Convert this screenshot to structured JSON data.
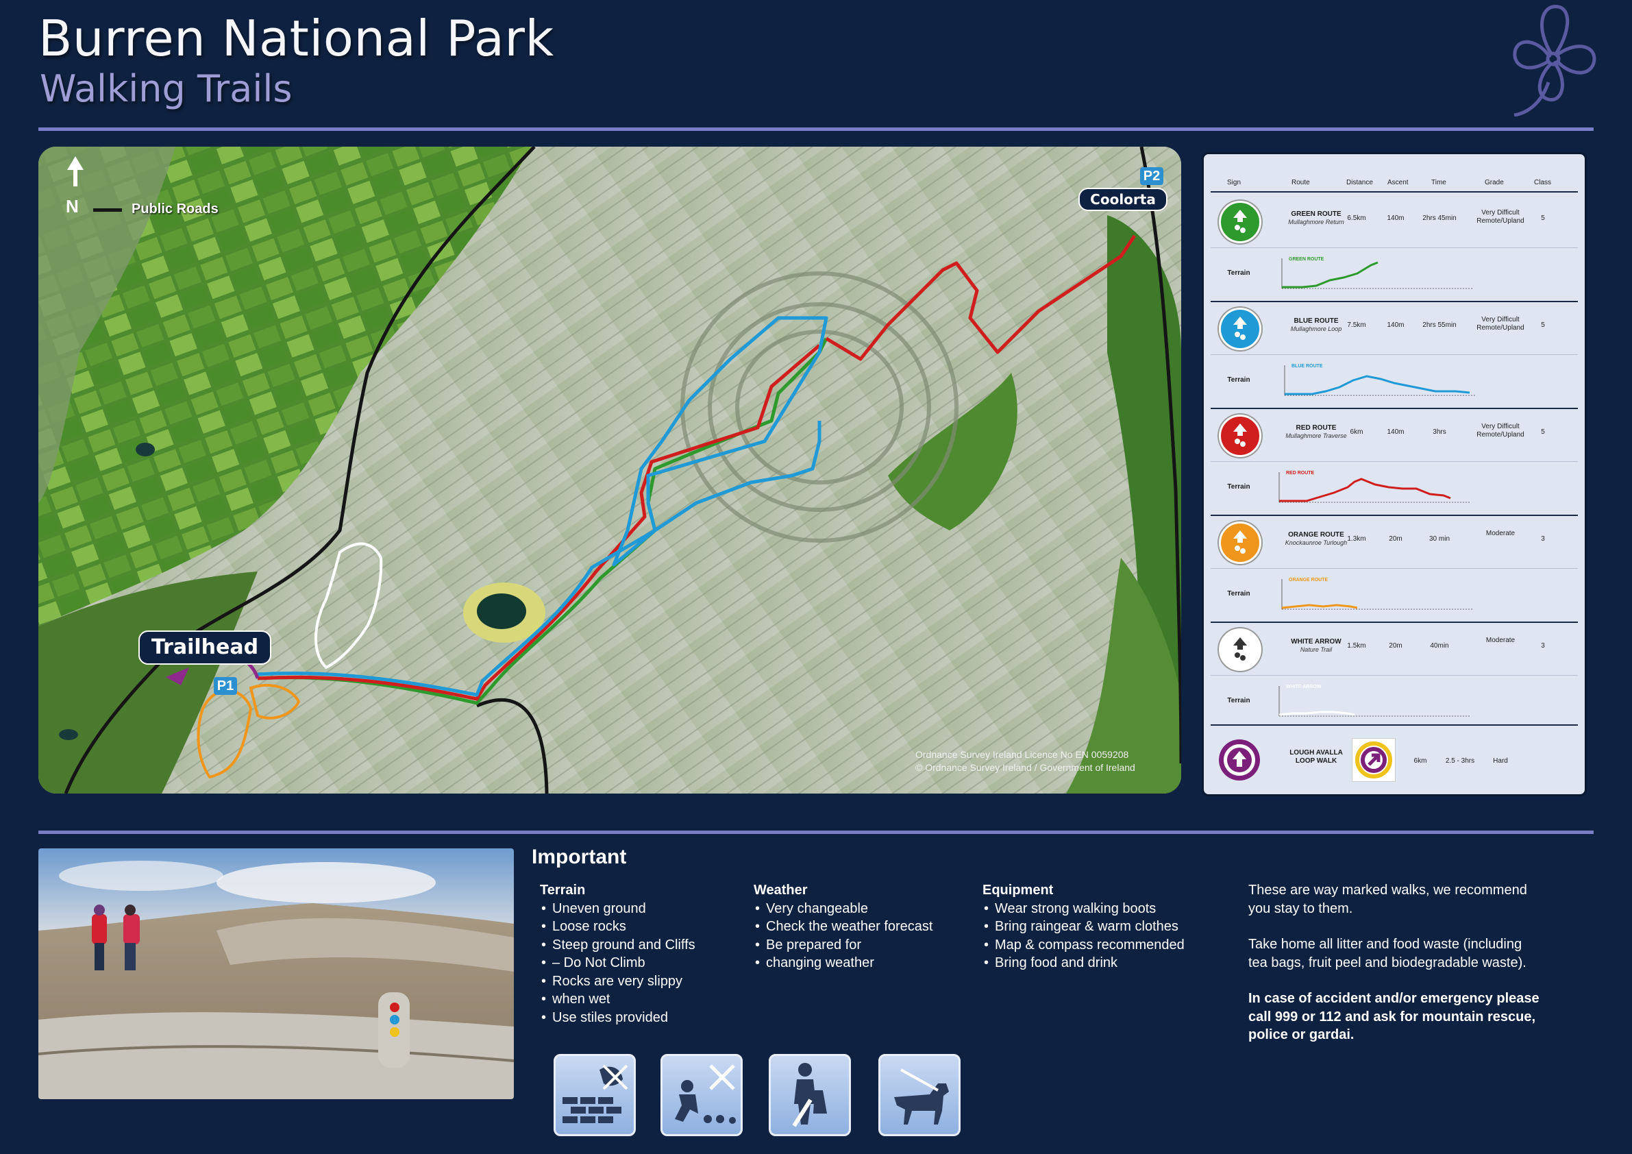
{
  "header": {
    "title": "Burren National Park",
    "subtitle": "Walking Trails"
  },
  "map": {
    "north_label": "N",
    "legend_roads": "Public Roads",
    "trailhead_label": "Trailhead",
    "coolorta_label": "Coolorta",
    "parking_1": "P1",
    "parking_2": "P2",
    "licence_line1": "Ordnance Survey Ireland Licence No EN 0059208",
    "licence_line2": "© Ordnance Survey Ireland / Government of Ireland"
  },
  "trail_table": {
    "headers": {
      "sign": "Sign",
      "route": "Route",
      "distance": "Distance",
      "ascent": "Ascent",
      "time": "Time",
      "grade": "Grade",
      "class": "Class"
    },
    "terrain_label": "Terrain",
    "routes": [
      {
        "name": "GREEN ROUTE",
        "sub": "Mullaghmore Return",
        "distance": "6.5km",
        "ascent": "140m",
        "time": "2hrs 45min",
        "grade_l1": "Very Difficult",
        "grade_l2": "Remote/Upland",
        "class": "5",
        "color": "#2e9a2e",
        "profile_label": "GREEN ROUTE"
      },
      {
        "name": "BLUE ROUTE",
        "sub": "Mullaghmore Loop",
        "distance": "7.5km",
        "ascent": "140m",
        "time": "2hrs 55min",
        "grade_l1": "Very Difficult",
        "grade_l2": "Remote/Upland",
        "class": "5",
        "color": "#1f9ad6",
        "profile_label": "BLUE ROUTE"
      },
      {
        "name": "RED ROUTE",
        "sub": "Mullaghmore Traverse",
        "distance": "6km",
        "ascent": "140m",
        "time": "3hrs",
        "grade_l1": "Very Difficult",
        "grade_l2": "Remote/Upland",
        "class": "5",
        "color": "#d01e1e",
        "profile_label": "RED ROUTE"
      },
      {
        "name": "ORANGE ROUTE",
        "sub": "Knockaunroe Turlough",
        "distance": "1.3km",
        "ascent": "20m",
        "time": "30 min",
        "grade_l1": "Moderate",
        "grade_l2": "",
        "class": "3",
        "color": "#f0961c",
        "profile_label": "ORANGE ROUTE"
      },
      {
        "name": "WHITE ARROW",
        "sub": "Nature Trail",
        "distance": "1.5km",
        "ascent": "20m",
        "time": "40min",
        "grade_l1": "Moderate",
        "grade_l2": "",
        "class": "3",
        "color": "#ffffff",
        "profile_label": "WHITE ARROW"
      }
    ],
    "lough": {
      "name_l1": "LOUGH AVALLA",
      "name_l2": "LOOP WALK",
      "distance": "6km",
      "time": "2.5 - 3hrs",
      "grade": "Hard",
      "color": "#7b1f7a"
    }
  },
  "important": {
    "heading": "Important",
    "terrain": {
      "title": "Terrain",
      "items": [
        "Uneven ground",
        "Loose rocks",
        "Steep ground and Cliffs",
        "– Do Not Climb",
        "Rocks are very slippy",
        "when wet",
        "Use stiles provided"
      ]
    },
    "weather": {
      "title": "Weather",
      "items": [
        "Very changeable",
        "Check the weather forecast",
        "Be prepared for",
        "changing weather"
      ]
    },
    "equipment": {
      "title": "Equipment",
      "items": [
        "Wear strong walking boots",
        "Bring raingear & warm clothes",
        "Map & compass recommended",
        "Bring food and drink"
      ]
    },
    "note1_l1": "These are way marked walks, we recommend",
    "note1_l2": "you stay to them.",
    "note2_l1": "Take home all litter and food waste (including",
    "note2_l2": "tea bags, fruit peel and biodegradable waste).",
    "note3_l1": "In case of accident and/or emergency please",
    "note3_l2": "call 999 or 112 and ask for mountain rescue,",
    "note3_l3": "police or gardai."
  },
  "pictograms": [
    "no-climbing-walls-icon",
    "no-picking-plants-icon",
    "take-litter-home-icon",
    "dogs-on-lead-icon"
  ]
}
